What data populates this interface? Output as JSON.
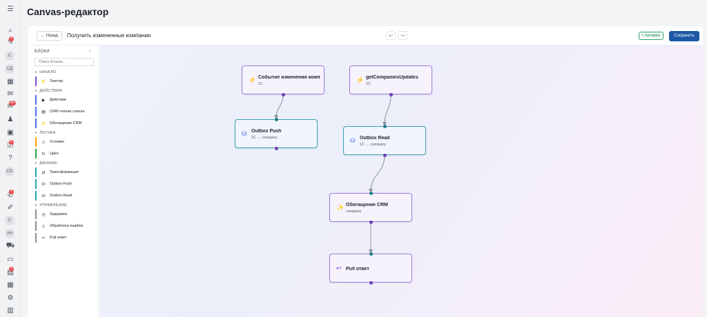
{
  "rail": {
    "badges": [
      "4",
      "99+",
      "6",
      "1",
      "2"
    ],
    "avatars": [
      "C",
      "CД",
      "CD",
      "C",
      "AH"
    ]
  },
  "page": {
    "title": "Canvas-редактор"
  },
  "toolbar": {
    "back_label": "← Назад",
    "title": "Получить измененные компании",
    "undo_icon": "undo-icon",
    "redo_icon": "redo-icon",
    "active_label": "• Активен",
    "save_label": "Сохранить"
  },
  "sidebar": {
    "header": "БЛОКИ",
    "search_placeholder": "Поиск блоков...",
    "groups": [
      {
        "label": "НАЧАЛО",
        "items": [
          {
            "label": "Триггер",
            "icon": "lightning-icon",
            "color": "#7c4dc9"
          }
        ]
      },
      {
        "label": "ДЕЙСТВИЯ",
        "items": [
          {
            "label": "Действие",
            "icon": "play-icon",
            "color": "#4c6ef5"
          },
          {
            "label": "CRM чтение списка",
            "icon": "list-icon",
            "color": "#4c6ef5"
          },
          {
            "label": "Обогащение CRM",
            "icon": "sparkle-icon",
            "color": "#4c6ef5"
          }
        ]
      },
      {
        "label": "ЛОГИКА",
        "items": [
          {
            "label": "Условие",
            "icon": "diamond-icon",
            "color": "#f59f00"
          },
          {
            "label": "Цикл",
            "icon": "loop-icon",
            "color": "#2f9e44"
          }
        ]
      },
      {
        "label": "ДАННЫЕ",
        "items": [
          {
            "label": "Трансформация",
            "icon": "swap-icon",
            "color": "#22a6b3"
          },
          {
            "label": "Outbox Push",
            "icon": "database-icon",
            "color": "#22a6b3"
          },
          {
            "label": "Outbox Read",
            "icon": "database-icon",
            "color": "#22a6b3"
          }
        ]
      },
      {
        "label": "УПРАВЛЕНИЕ",
        "items": [
          {
            "label": "Задержка",
            "icon": "clock-icon",
            "color": "#868e96"
          },
          {
            "label": "Обработка ошибок",
            "icon": "warning-icon",
            "color": "#868e96"
          },
          {
            "label": "Pull ответ",
            "icon": "reply-icon",
            "color": "#868e96"
          }
        ]
      }
    ]
  },
  "canvas": {
    "nodes": [
      {
        "id": "n1",
        "title": "Событие изменения компании",
        "subtitle": "1C",
        "icon": "lightning-icon",
        "style": "purple"
      },
      {
        "id": "n2",
        "title": "getCompaniesUpdates",
        "subtitle": "1C",
        "icon": "lightning-icon",
        "style": "purple"
      },
      {
        "id": "n3",
        "title": "Outbox Push",
        "subtitle": "1C → company",
        "icon": "database-icon",
        "style": "teal"
      },
      {
        "id": "n4",
        "title": "Outbox Read",
        "subtitle": "1C → company",
        "icon": "database-icon",
        "style": "teal"
      },
      {
        "id": "n5",
        "title": "Обогащение CRM",
        "subtitle": "company",
        "icon": "sparkle-icon",
        "style": "purple"
      },
      {
        "id": "n6",
        "title": "Pull ответ",
        "subtitle": "",
        "icon": "reply-icon",
        "style": "purple"
      }
    ],
    "edges": [
      [
        "n1",
        "n3"
      ],
      [
        "n2",
        "n4"
      ],
      [
        "n4",
        "n5"
      ],
      [
        "n5",
        "n6"
      ]
    ]
  }
}
